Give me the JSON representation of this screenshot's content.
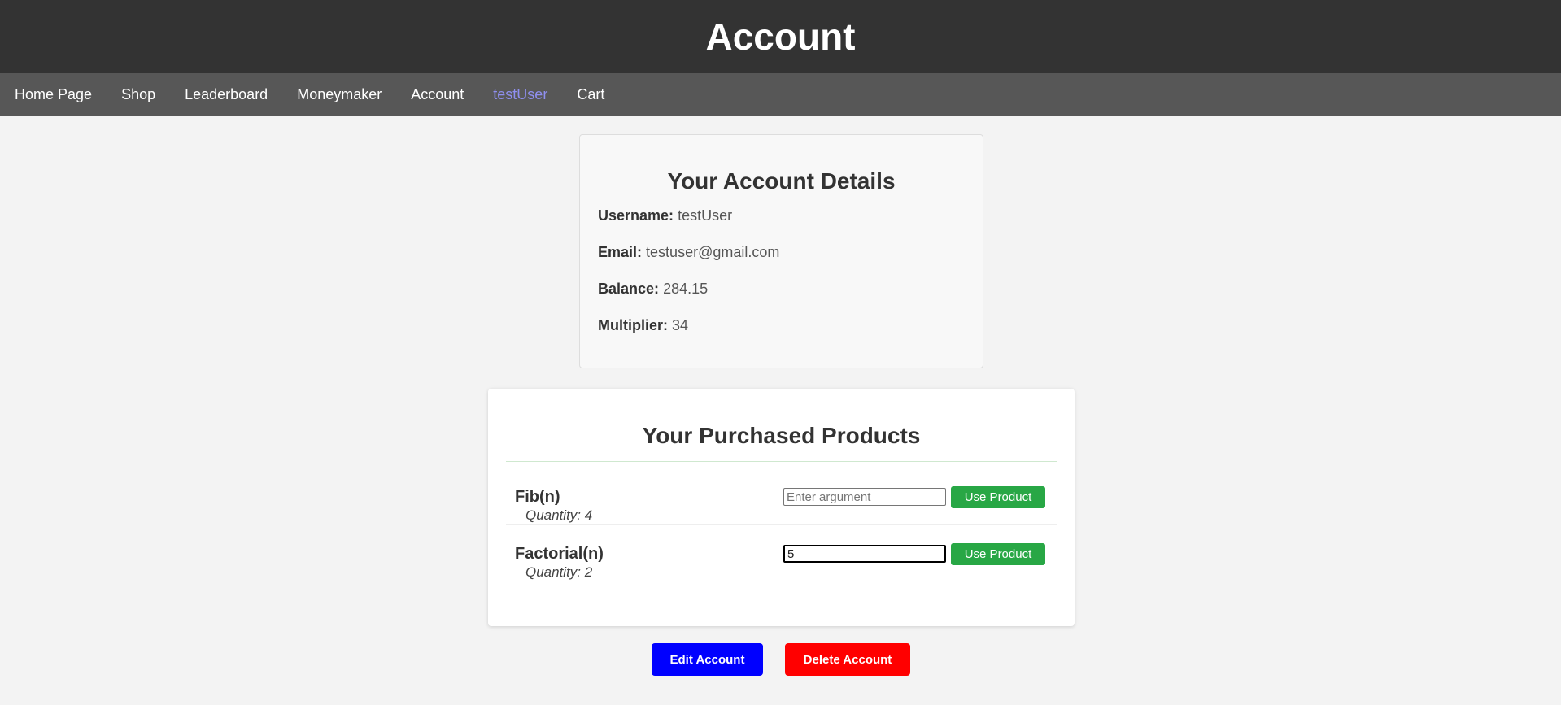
{
  "header": {
    "title": "Account"
  },
  "nav": {
    "items": [
      {
        "label": "Home Page",
        "active": false
      },
      {
        "label": "Shop",
        "active": false
      },
      {
        "label": "Leaderboard",
        "active": false
      },
      {
        "label": "Moneymaker",
        "active": false
      },
      {
        "label": "Account",
        "active": false
      },
      {
        "label": "testUser",
        "active": true
      },
      {
        "label": "Cart",
        "active": false
      }
    ]
  },
  "account_details": {
    "title": "Your Account Details",
    "fields": [
      {
        "label": "Username:",
        "value": "testUser"
      },
      {
        "label": "Email:",
        "value": "testuser@gmail.com"
      },
      {
        "label": "Balance:",
        "value": "284.15"
      },
      {
        "label": "Multiplier:",
        "value": "34"
      }
    ]
  },
  "purchased_products": {
    "title": "Your Purchased Products",
    "items": [
      {
        "name": "Fib(n)",
        "quantity": "Quantity: 4",
        "argument_value": "",
        "argument_placeholder": "Enter argument",
        "button_label": "Use Product"
      },
      {
        "name": "Factorial(n)",
        "quantity": "Quantity: 2",
        "argument_value": "5",
        "argument_placeholder": "Enter argument",
        "button_label": "Use Product"
      }
    ]
  },
  "actions": {
    "edit_label": "Edit Account",
    "delete_label": "Delete Account"
  },
  "colors": {
    "header_bg": "#333333",
    "nav_bg": "#575757",
    "nav_active": "#8f8ff0",
    "use_button": "#28a745",
    "edit_button": "#0000ff",
    "delete_button": "#ff0000"
  }
}
